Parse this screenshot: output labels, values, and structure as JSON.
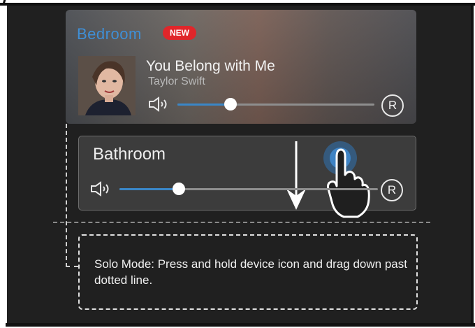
{
  "bedroom": {
    "room_name": "Bedroom",
    "badge": "NEW",
    "track_title": "You Belong with Me",
    "artist": "Taylor Swift",
    "volume_percent": 27,
    "album_art_icon": "album-cover-portrait",
    "r_label": "R"
  },
  "bathroom": {
    "room_name": "Bathroom",
    "volume_percent": 23,
    "r_label": "R"
  },
  "instruction": {
    "text": "Solo Mode: Press and hold device icon and drag down past dotted line."
  },
  "colors": {
    "accent": "#3a87c8",
    "badge": "#e0262a",
    "background": "#202020"
  },
  "icons": [
    "speaker-icon",
    "r-circle-icon",
    "hand-pointer-icon",
    "down-arrow-icon"
  ]
}
